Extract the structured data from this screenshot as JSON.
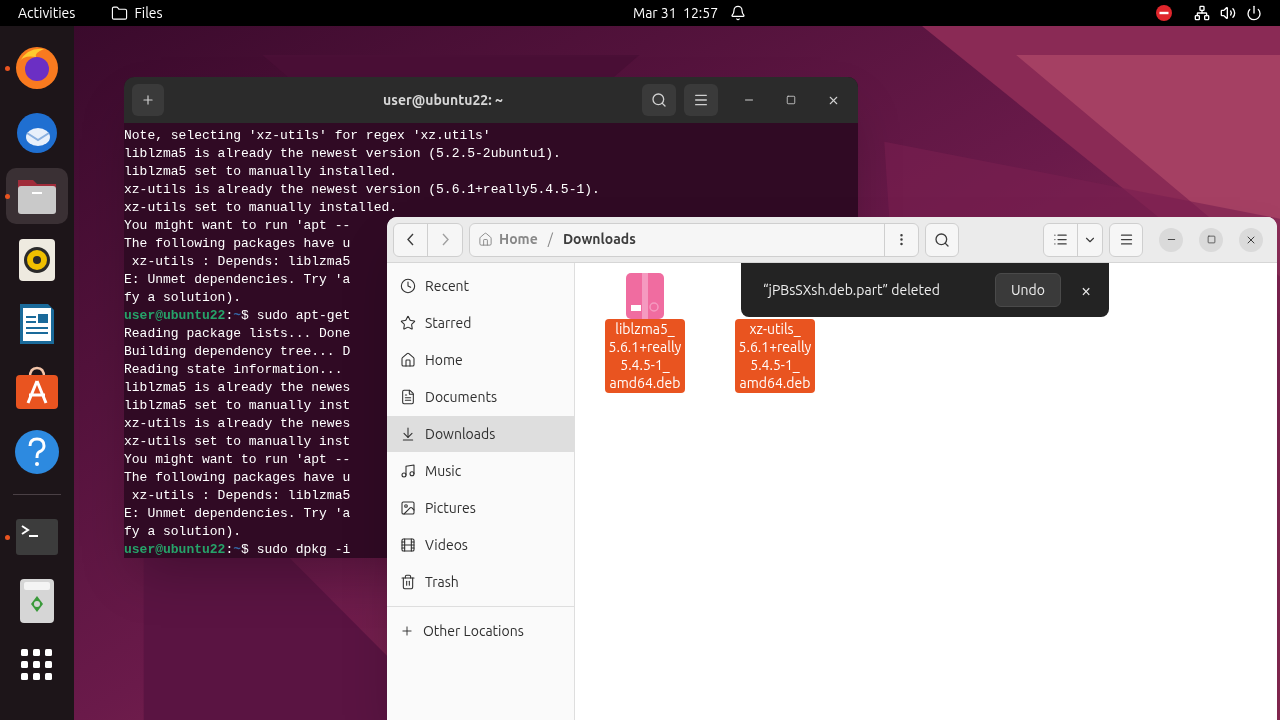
{
  "top_bar": {
    "activities": "Activities",
    "app_name": "Files",
    "clock": "Mar 31  12:57"
  },
  "dock": [
    {
      "kind": "browser",
      "running": true,
      "selected": false
    },
    {
      "kind": "mail",
      "running": false,
      "selected": false
    },
    {
      "kind": "files",
      "running": true,
      "selected": true
    },
    {
      "kind": "music",
      "running": false,
      "selected": false
    },
    {
      "kind": "writer",
      "running": false,
      "selected": false
    },
    {
      "kind": "store",
      "running": false,
      "selected": false
    },
    {
      "kind": "help",
      "running": false,
      "selected": false
    },
    {
      "kind": "separator"
    },
    {
      "kind": "terminal",
      "running": true,
      "selected": false
    },
    {
      "kind": "trash",
      "running": false,
      "selected": false
    },
    {
      "kind": "apps",
      "running": false,
      "selected": false
    }
  ],
  "terminal": {
    "title": "user@ubuntu22: ~",
    "lines": [
      {
        "kind": "output",
        "text": "Note, selecting 'xz-utils' for regex 'xz.utils'"
      },
      {
        "kind": "output",
        "text": "liblzma5 is already the newest version (5.2.5-2ubuntu1)."
      },
      {
        "kind": "output",
        "text": "liblzma5 set to manually installed."
      },
      {
        "kind": "output",
        "text": "xz-utils is already the newest version (5.6.1+really5.4.5-1)."
      },
      {
        "kind": "output",
        "text": "xz-utils set to manually installed."
      },
      {
        "kind": "output",
        "text": "You might want to run 'apt --"
      },
      {
        "kind": "output",
        "text": "The following packages have u"
      },
      {
        "kind": "output",
        "text": " xz-utils : Depends: liblzma5"
      },
      {
        "kind": "output",
        "text": "E: Unmet dependencies. Try 'a"
      },
      {
        "kind": "output",
        "text": "fy a solution)."
      },
      {
        "kind": "prompt",
        "user": "user@ubuntu22",
        "separator": ":",
        "path": "~",
        "command": "$ sudo apt-get"
      },
      {
        "kind": "output",
        "text": "Reading package lists... Done"
      },
      {
        "kind": "output",
        "text": "Building dependency tree... D"
      },
      {
        "kind": "output",
        "text": "Reading state information..."
      },
      {
        "kind": "output",
        "text": "liblzma5 is already the newes"
      },
      {
        "kind": "output",
        "text": "liblzma5 set to manually inst"
      },
      {
        "kind": "output",
        "text": "xz-utils is already the newes"
      },
      {
        "kind": "output",
        "text": "xz-utils set to manually inst"
      },
      {
        "kind": "output",
        "text": "You might want to run 'apt --"
      },
      {
        "kind": "output",
        "text": "The following packages have u"
      },
      {
        "kind": "output",
        "text": " xz-utils : Depends: liblzma5"
      },
      {
        "kind": "output",
        "text": "E: Unmet dependencies. Try 'a"
      },
      {
        "kind": "output",
        "text": "fy a solution)."
      },
      {
        "kind": "prompt",
        "user": "user@ubuntu22",
        "separator": ":",
        "path": "~",
        "command": "$ sudo dpkg -i"
      }
    ]
  },
  "files": {
    "path": [
      "Home",
      "Downloads"
    ],
    "path_separator": "/",
    "sidebar": [
      {
        "kind": "recent",
        "label": "Recent",
        "selected": false
      },
      {
        "kind": "starred",
        "label": "Starred",
        "selected": false
      },
      {
        "kind": "home",
        "label": "Home",
        "selected": false
      },
      {
        "kind": "documents",
        "label": "Documents",
        "selected": false
      },
      {
        "kind": "downloads",
        "label": "Downloads",
        "selected": true
      },
      {
        "kind": "music",
        "label": "Music",
        "selected": false
      },
      {
        "kind": "pictures",
        "label": "Pictures",
        "selected": false
      },
      {
        "kind": "videos",
        "label": "Videos",
        "selected": false
      },
      {
        "kind": "trash",
        "label": "Trash",
        "selected": false
      }
    ],
    "other_locations": "Other Locations",
    "items": [
      {
        "kind": "archive",
        "name_lines": [
          "liblzma5_",
          "5.6.1+really",
          "5.4.5-1_",
          "amd64.deb"
        ],
        "selected": true
      },
      {
        "kind": "hidden",
        "name_lines": [
          "xz-utils_",
          "5.6.1+really",
          "5.4.5-1_",
          "amd64.deb"
        ],
        "selected": true
      }
    ],
    "toast": {
      "message": "“jPBsSXsh.deb.part” deleted",
      "action": "Undo",
      "close": "×"
    }
  }
}
